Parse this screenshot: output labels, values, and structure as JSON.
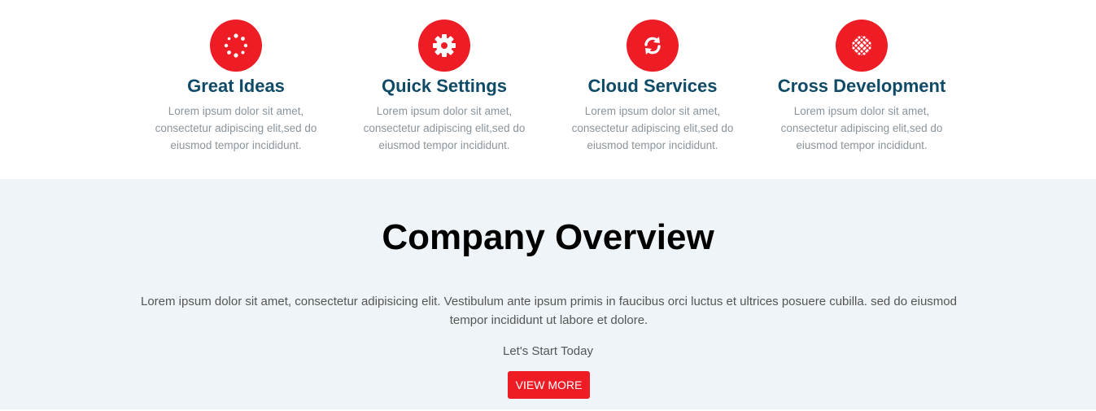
{
  "features": [
    {
      "icon": "spinner-icon",
      "title": "Great Ideas",
      "text": "Lorem ipsum dolor sit amet, consectetur adipiscing elit,sed do eiusmod tempor incididunt."
    },
    {
      "icon": "gear-icon",
      "title": "Quick Settings",
      "text": "Lorem ipsum dolor sit amet, consectetur adipiscing elit,sed do eiusmod tempor incididunt."
    },
    {
      "icon": "refresh-icon",
      "title": "Cloud Services",
      "text": "Lorem ipsum dolor sit amet, consectetur adipiscing elit,sed do eiusmod tempor incididunt."
    },
    {
      "icon": "grid-globe-icon",
      "title": "Cross Development",
      "text": "Lorem ipsum dolor sit amet, consectetur adipiscing elit,sed do eiusmod tempor incididunt."
    }
  ],
  "overview": {
    "title": "Company Overview",
    "description": "Lorem ipsum dolor sit amet, consectetur adipisicing elit. Vestibulum ante ipsum primis in faucibus orci luctus et ultrices posuere cubilla. sed do eiusmod tempor incididunt ut labore et dolore.",
    "cta_text": "Let's Start Today",
    "button_label": "VIEW MORE"
  },
  "colors": {
    "accent": "#ee1c25",
    "heading": "#0f4a67",
    "section_bg": "#eef4f7"
  }
}
